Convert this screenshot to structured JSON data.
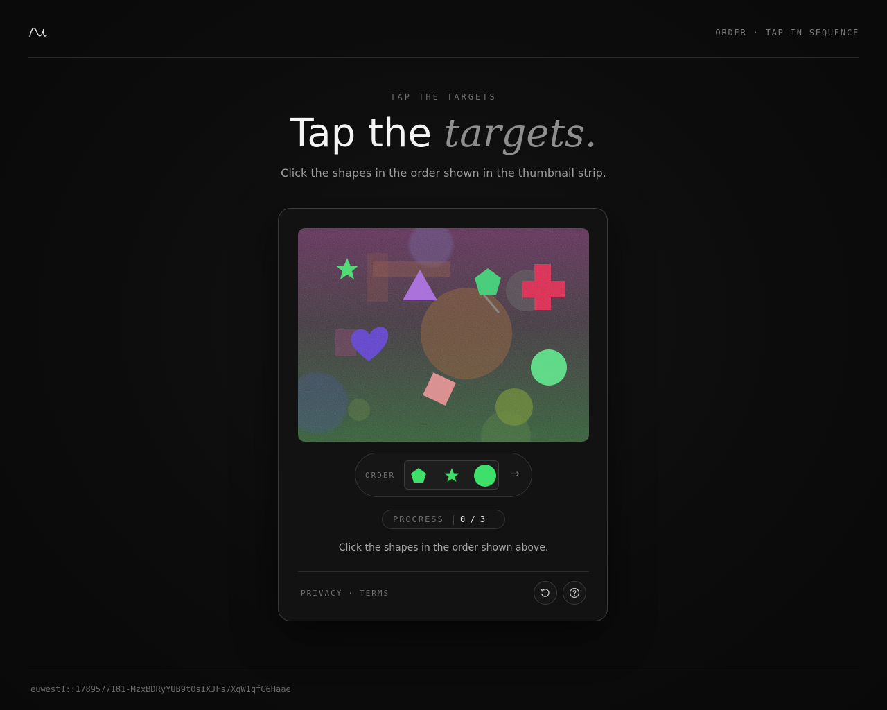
{
  "header": {
    "mode_text": "ORDER · TAP IN SEQUENCE",
    "logo_icon": "wave-logo-icon"
  },
  "hero": {
    "eyebrow": "TAP THE TARGETS",
    "title_main": "Tap the ",
    "title_emphasis": "targets.",
    "subtitle": "Click the shapes in the order shown in the thumbnail strip."
  },
  "challenge": {
    "order_label": "ORDER",
    "order_sequence": [
      "pentagon",
      "star",
      "circle"
    ],
    "target_color": "#3fe06a",
    "next_icon": "arrow-right-icon",
    "next_glyph": "→",
    "progress_label": "PROGRESS",
    "progress_value": "0 / 3",
    "progress_current": 0,
    "progress_total": 3,
    "instructions": "Click the shapes in the order shown above.",
    "canvas_shapes": [
      "star",
      "triangle",
      "pentagon",
      "cross",
      "heart",
      "circle",
      "square"
    ]
  },
  "card_footer": {
    "privacy_label": "PRIVACY",
    "separator": "·",
    "terms_label": "TERMS",
    "reload_icon": "reload-icon",
    "help_icon": "help-icon"
  },
  "footer": {
    "session_id": "euwest1::1789577181-MzxBDRyYUB9t0sIXJFs7XqW1qfG6Haae"
  }
}
